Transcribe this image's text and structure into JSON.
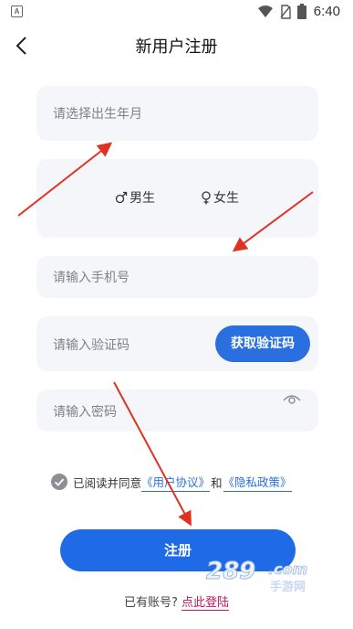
{
  "status_bar": {
    "app_badge": "A",
    "time": "6:40",
    "icons": [
      "wifi-icon",
      "no-sim-icon",
      "battery-icon"
    ]
  },
  "header": {
    "title": "新用户注册",
    "back_icon": "chevron-left-icon"
  },
  "form": {
    "birth_placeholder": "请选择出生年月",
    "gender": {
      "male_label": "男生",
      "female_label": "女生"
    },
    "phone_placeholder": "请输入手机号",
    "code_placeholder": "请输入验证码",
    "code_button_label": "获取验证码",
    "password_placeholder": "请输入密码",
    "password_toggle_icon": "eye-icon"
  },
  "agreement": {
    "prefix": "已阅读并同意",
    "user_agreement": "《用户协议》",
    "conjunction": "和",
    "privacy_policy": "《隐私政策》"
  },
  "register_label": "注册",
  "login_prompt": {
    "text": "已有账号?",
    "link": "点此登陆"
  },
  "watermark": {
    "brand": "289.com",
    "subtitle": "手游网"
  },
  "colors": {
    "accent": "#1f6ae6",
    "field_bg": "#f4f6f9",
    "login_link": "#c2185b",
    "arrow": "#e03222"
  }
}
